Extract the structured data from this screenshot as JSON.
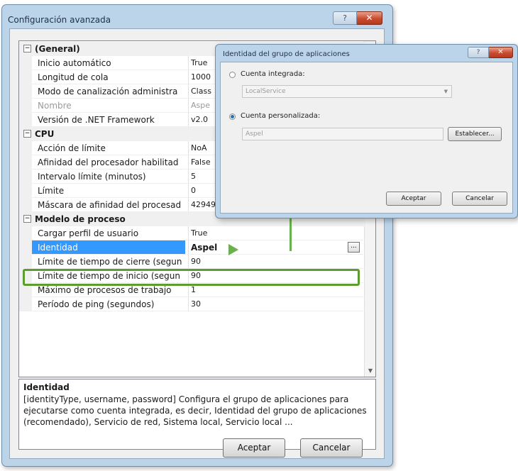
{
  "main_window": {
    "title": "Configuración avanzada",
    "help_glyph": "?",
    "close_glyph": "✕"
  },
  "property_grid": {
    "rows": [
      {
        "kind": "category",
        "label": "(General)",
        "expander": "−"
      },
      {
        "kind": "property",
        "name": "Inicio automático",
        "value": "True"
      },
      {
        "kind": "property",
        "name": "Longitud de cola",
        "value": "1000"
      },
      {
        "kind": "property",
        "name": "Modo de canalización administra",
        "value": "Class"
      },
      {
        "kind": "property",
        "name": "Nombre",
        "value": "Aspe",
        "disabled": true
      },
      {
        "kind": "property",
        "name": "Versión de .NET Framework",
        "value": "v2.0"
      },
      {
        "kind": "category",
        "label": "CPU",
        "expander": "−"
      },
      {
        "kind": "property",
        "name": "Acción de límite",
        "value": "NoA"
      },
      {
        "kind": "property",
        "name": "Afinidad del procesador habilitad",
        "value": "False"
      },
      {
        "kind": "property",
        "name": "Intervalo límite (minutos)",
        "value": "5"
      },
      {
        "kind": "property",
        "name": "Límite",
        "value": "0"
      },
      {
        "kind": "property",
        "name": "Máscara de afinidad del procesad",
        "value": "4294967295"
      },
      {
        "kind": "category",
        "label": "Modelo de proceso",
        "expander": "−"
      },
      {
        "kind": "property",
        "name": "Cargar perfil de usuario",
        "value": "True"
      },
      {
        "kind": "property",
        "name": "Identidad",
        "value": "Aspel",
        "selected": true,
        "ellipsis": "..."
      },
      {
        "kind": "property",
        "name": "Límite de tiempo de cierre (segun",
        "value": "90"
      },
      {
        "kind": "property",
        "name": "Límite de tiempo de inicio (segun",
        "value": "90"
      },
      {
        "kind": "property",
        "name": "Máximo de procesos de trabajo",
        "value": "1"
      },
      {
        "kind": "property",
        "name": "Período de ping (segundos)",
        "value": "30"
      }
    ],
    "scroll_down_glyph": "▼"
  },
  "description": {
    "title": "Identidad",
    "text": "[identityType, username, password] Configura el grupo de aplicaciones para ejecutarse como cuenta integrada, es decir, Identidad del grupo de aplicaciones (recomendado), Servicio de red, Sistema local, Servicio local ..."
  },
  "buttons": {
    "accept": "Aceptar",
    "cancel": "Cancelar"
  },
  "dialog": {
    "title": "Identidad del grupo de aplicaciones",
    "help_glyph": "?",
    "close_glyph": "✕",
    "builtin_label": "Cuenta integrada:",
    "builtin_value": "LocalService",
    "dropdown_glyph": "▼",
    "custom_label": "Cuenta personalizada:",
    "custom_value": "Aspel",
    "set_button": "Establecer...",
    "accept": "Aceptar",
    "cancel": "Cancelar",
    "selected_option": "Cuenta personalizada"
  },
  "colors": {
    "highlight": "#5d9c2e",
    "selection": "#3399ff",
    "close_button": "#c94b2f"
  }
}
